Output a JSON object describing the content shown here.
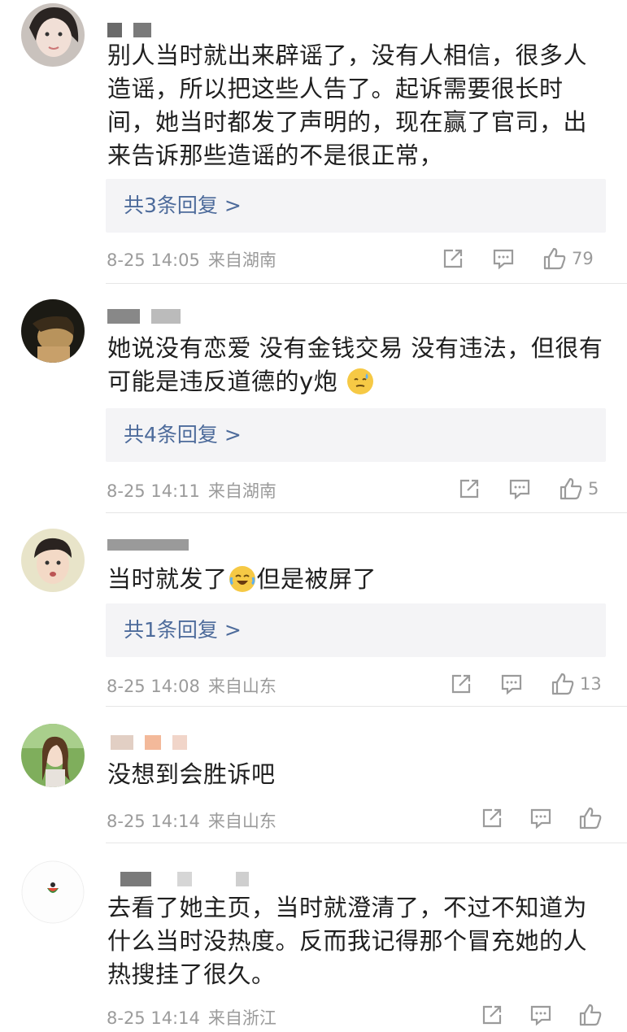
{
  "comments": [
    {
      "text_a": "别人当时就出来辟谣了，没有人相信，很多人造谣，所以把这些人告了。起诉需要很长时间，她当时都发了声明的，现在赢了官司，出来告诉那些造谣的不是很正常，",
      "replies": "共3条回复 >",
      "date": "8-25 14:05",
      "source": "来自湖南",
      "likes": "79"
    },
    {
      "text_a": "她说没有恋爱 没有金钱交易 没有违法，但很有可能是违反道德的y炮",
      "emoji": "sweat-smile-emoji",
      "replies": "共4条回复 >",
      "date": "8-25 14:11",
      "source": "来自湖南",
      "likes": "5"
    },
    {
      "text_a": "当时就发了",
      "emoji": "crying-laugh-emoji",
      "text_b": "但是被屏了",
      "replies": "共1条回复 >",
      "date": "8-25 14:08",
      "source": "来自山东",
      "likes": "13"
    },
    {
      "text_a": "没想到会胜诉吧",
      "date": "8-25 14:14",
      "source": "来自山东"
    },
    {
      "text_a": "去看了她主页，当时就澄清了，不过不知道为什么当时没热度。反而我记得那个冒充她的人热搜挂了很久。",
      "date": "8-25 14:14",
      "source": "来自浙江"
    }
  ],
  "colors": {
    "link": "#4d6b9b",
    "meta": "#9b9b9b",
    "reply_bg": "#f4f4f6"
  },
  "icons": [
    "share-icon",
    "comment-icon",
    "like-icon"
  ]
}
